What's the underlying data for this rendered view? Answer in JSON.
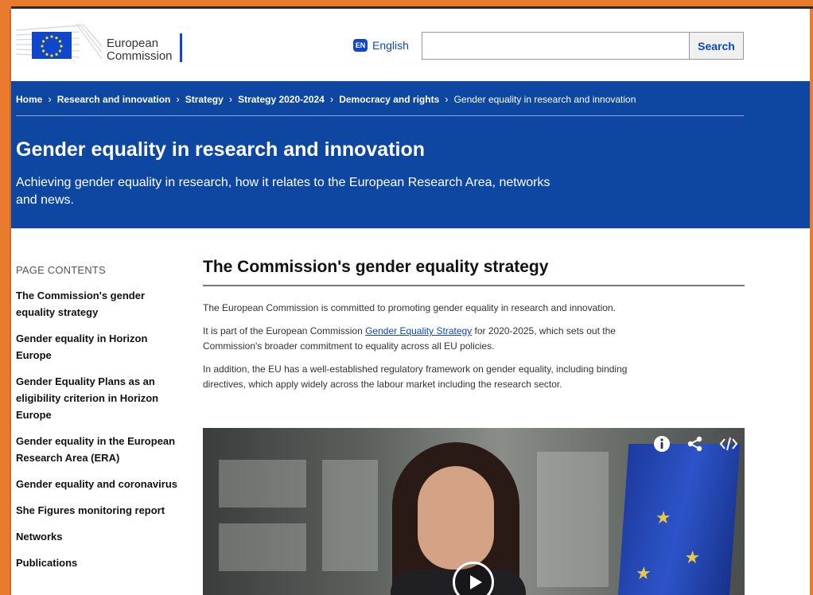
{
  "header": {
    "logo_line1": "European",
    "logo_line2": "Commission",
    "language_code": "EN",
    "language_label": "English",
    "search_placeholder": "",
    "search_button": "Search"
  },
  "breadcrumb": [
    "Home",
    "Research and innovation",
    "Strategy",
    "Strategy 2020-2024",
    "Democracy and rights",
    "Gender equality in research and innovation"
  ],
  "banner": {
    "title": "Gender equality in research and innovation",
    "description": "Achieving gender equality in research, how it relates to the European Research Area, networks and news."
  },
  "sidebar": {
    "heading": "PAGE CONTENTS",
    "items": [
      "The Commission's gender equality strategy",
      "Gender equality in Horizon Europe",
      "Gender Equality Plans as an eligibility criterion in Horizon Europe",
      "Gender equality in the European Research Area (ERA)",
      "Gender equality and coronavirus",
      "She Figures monitoring report",
      "Networks",
      "Publications"
    ]
  },
  "main": {
    "heading": "The Commission's gender equality strategy",
    "para1": "The European Commission is committed to promoting gender equality in research and innovation.",
    "para2_before": "It is part of the European Commission ",
    "para2_link": "Gender Equality Strategy",
    "para2_after": " for 2020-2025, which sets out the Commission's broader commitment to equality across all EU policies.",
    "para3": "In addition, the EU has a well-established regulatory framework on gender equality, including binding directives, which apply widely across the labour market including the research sector."
  },
  "video": {
    "controls": [
      "info-icon",
      "share-icon",
      "embed-code-icon"
    ]
  },
  "colors": {
    "brand_blue": "#0e47a1",
    "link_blue": "#0e47cb",
    "frame_orange": "#e87b2c"
  }
}
